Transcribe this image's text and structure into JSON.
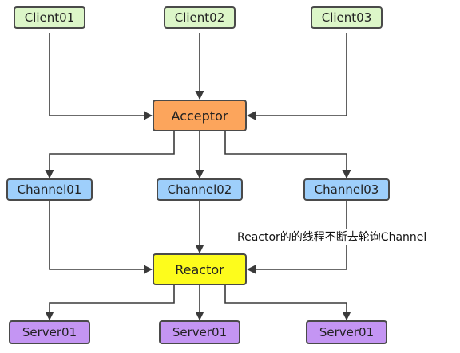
{
  "clients": [
    {
      "label": "Client01"
    },
    {
      "label": "Client02"
    },
    {
      "label": "Client03"
    }
  ],
  "acceptor": {
    "label": "Acceptor"
  },
  "channels": [
    {
      "label": "Channel01"
    },
    {
      "label": "Channel02"
    },
    {
      "label": "Channel03"
    }
  ],
  "reactor": {
    "label": "Reactor"
  },
  "servers": [
    {
      "label": "Server01"
    },
    {
      "label": "Server01"
    },
    {
      "label": "Server01"
    }
  ],
  "annotation": "Reactor的的线程不断去轮询Channel",
  "colors": {
    "client": "#dcf6c8",
    "acceptor": "#fca55c",
    "channel": "#9ecffb",
    "reactor": "#fdfc1c",
    "server": "#c495f3",
    "line": "#3a3a3a"
  }
}
